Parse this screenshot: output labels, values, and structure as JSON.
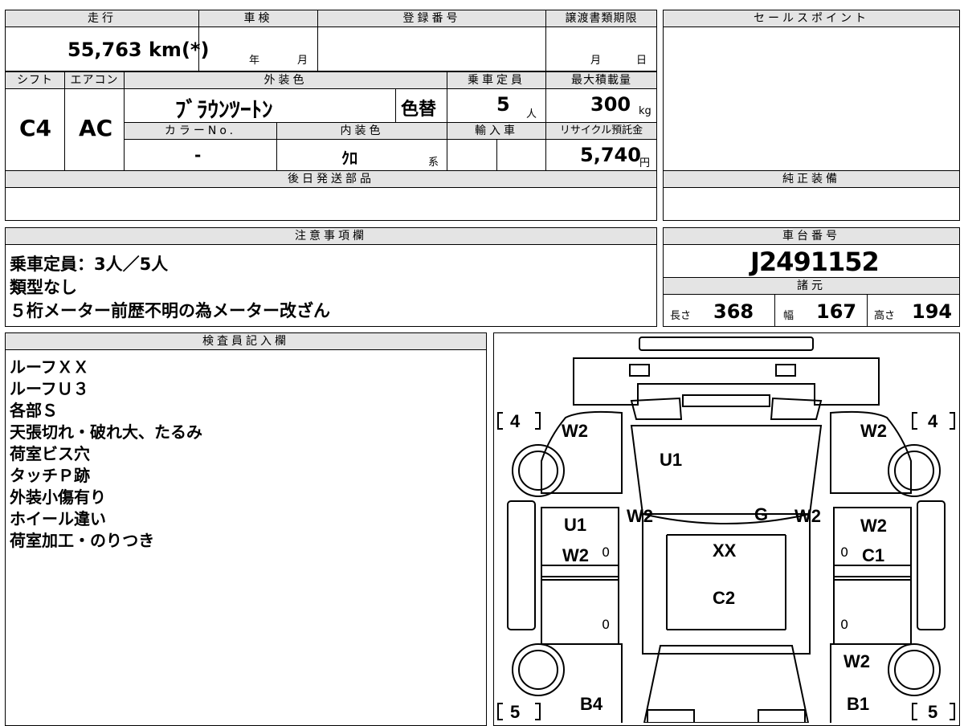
{
  "top": {
    "mileage_header": "走行",
    "mileage_value": "55,763 km(*)",
    "inspection_header": "車検",
    "inspection_year": "年",
    "inspection_month": "月",
    "registration_header": "登録番号",
    "transfer_header": "譲渡書類期限",
    "transfer_month": "月",
    "transfer_day": "日"
  },
  "specs": {
    "shift_header": "シフト",
    "shift_value": "C4",
    "ac_header": "エアコン",
    "ac_value": "AC",
    "exterior_header": "外装色",
    "exterior_value": "ﾌﾞﾗｳﾝﾂｰﾄﾝ",
    "repaint_label": "色替",
    "capacity_header": "乗車定員",
    "capacity_value": "5",
    "capacity_unit": "人",
    "load_header": "最大積載量",
    "load_value": "300",
    "load_unit": "kg",
    "color_no_header": "カラーNo.",
    "color_no_value": "-",
    "interior_header": "内装色",
    "interior_value": "ｸﾛ",
    "interior_suffix": "系",
    "import_header": "輸入車",
    "recycle_header": "リサイクル預託金",
    "recycle_value": "5,740",
    "recycle_unit": "円",
    "later_parts_header": "後日発送部品"
  },
  "right": {
    "sales_header": "セールスポイント",
    "genuine_header": "純正装備",
    "chassis_header": "車台番号",
    "chassis_value": "J2491152",
    "dims_header": "諸元",
    "length_label": "長さ",
    "length_value": "368",
    "width_label": "幅",
    "width_value": "167",
    "height_label": "高さ",
    "height_value": "194"
  },
  "notes": {
    "header": "注意事項欄",
    "lines": [
      "乗車定員：3人／5人",
      "類型なし",
      "５桁メーター前歴不明の為メーター改ざん"
    ]
  },
  "inspector": {
    "header": "検査員記入欄",
    "lines": [
      "ルーフＸＸ",
      "ルーフＵ３",
      "各部Ｓ",
      "天張切れ・破れ大、たるみ",
      "荷室ビス穴",
      "タッチＰ跡",
      "外装小傷有り",
      "ホイール違い",
      "荷室加工・のりつき"
    ]
  },
  "diagram": {
    "tire_fl": "4",
    "tire_fr": "4",
    "tire_rl": "5",
    "tire_rr": "5",
    "labels": [
      "W2",
      "W2",
      "U1",
      "W2",
      "G",
      "W2",
      "U1",
      "W2",
      "W2",
      "C1",
      "XX",
      "C2",
      "W2",
      "B4",
      "B1"
    ],
    "zeros": [
      "0",
      "0",
      "0",
      "0"
    ]
  }
}
